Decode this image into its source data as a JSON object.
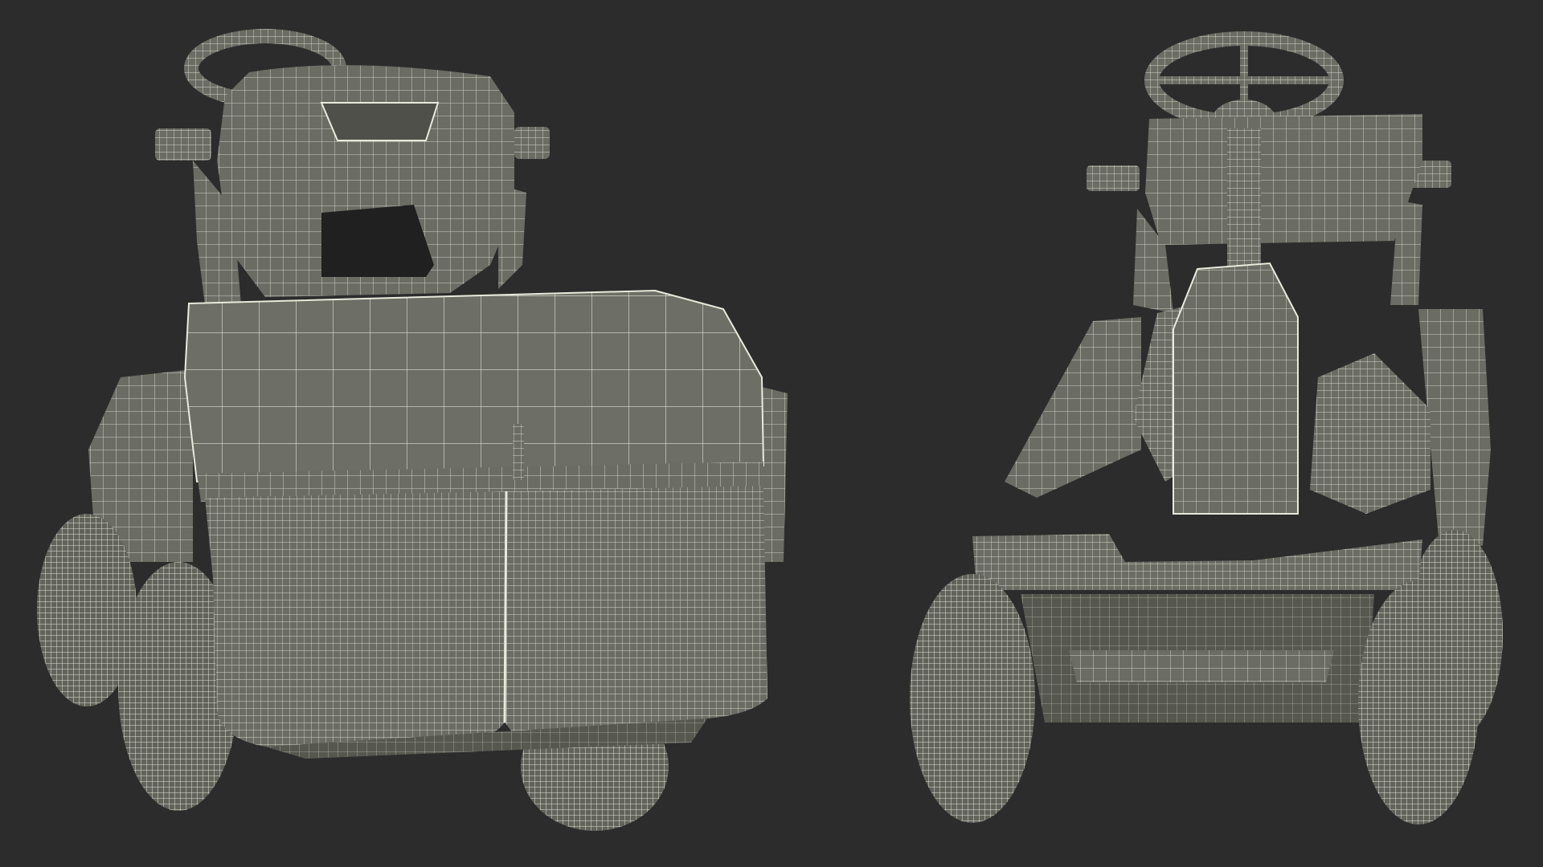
{
  "scene": {
    "background": "#2c2c2c",
    "mesh_fill": "#6b6c64",
    "mesh_fill_dark": "#5a5b54",
    "wire_color": "#e9e9dc",
    "views": [
      {
        "id": "rear-view",
        "subject": "riding-lawn-mower-rear-wireframe"
      },
      {
        "id": "front-view",
        "subject": "riding-lawn-mower-front-wireframe"
      }
    ]
  }
}
